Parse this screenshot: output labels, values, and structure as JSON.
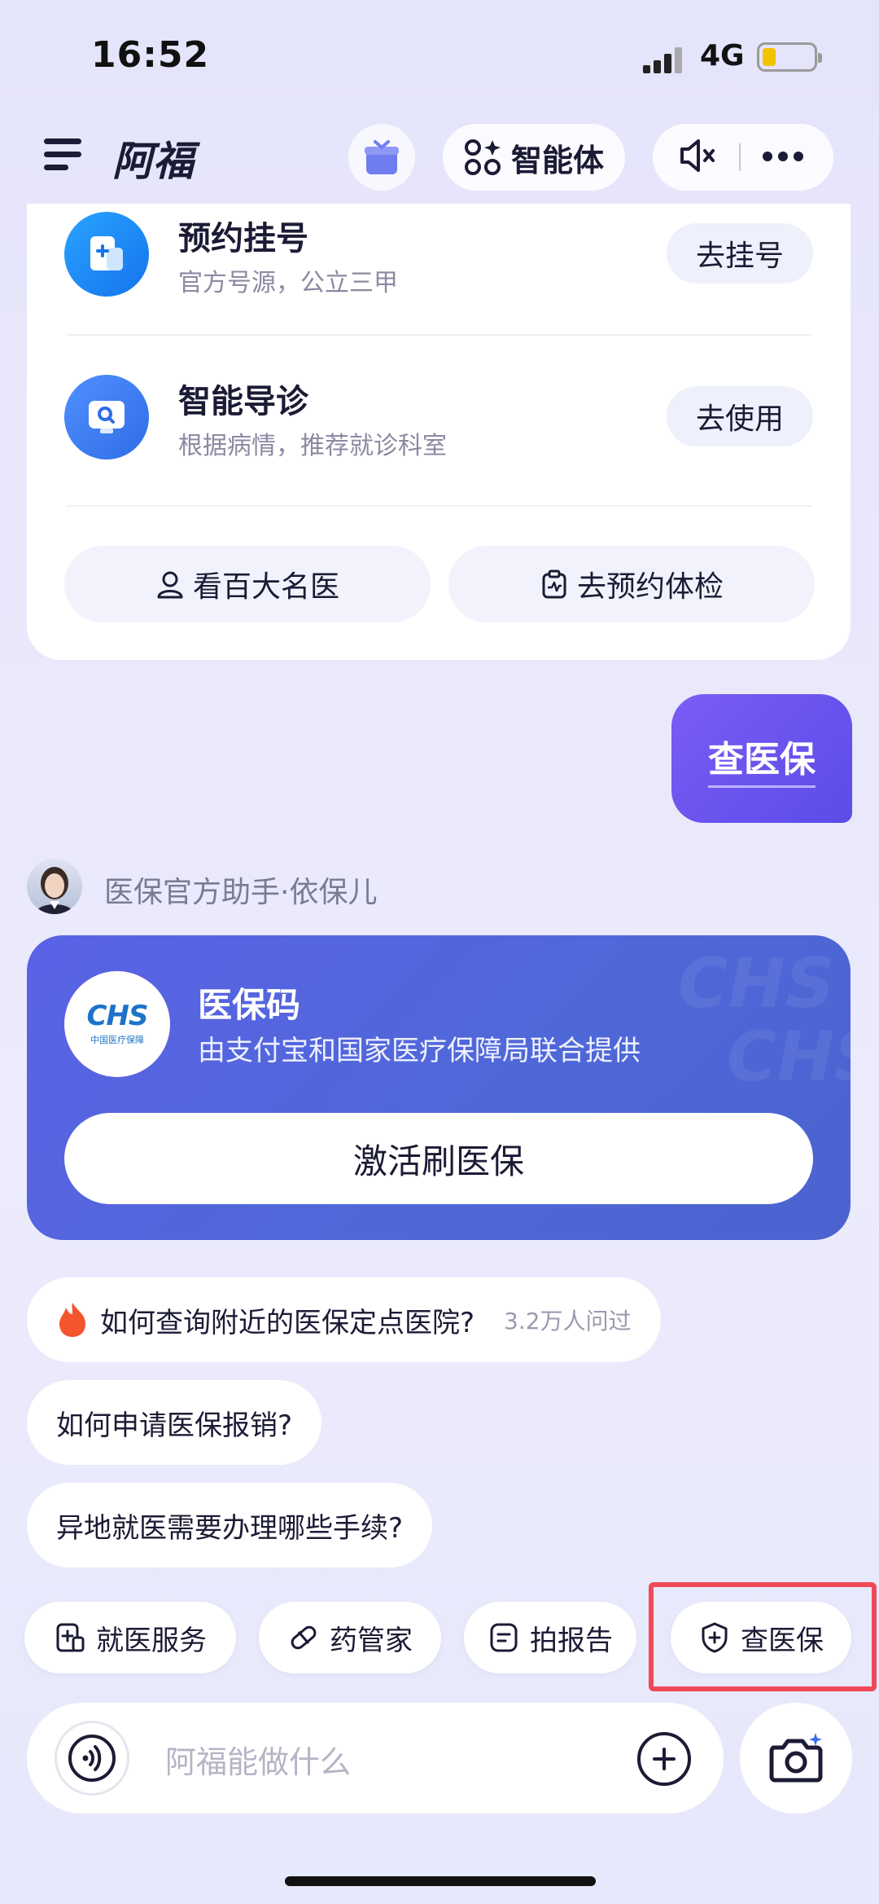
{
  "status": {
    "time": "16:52",
    "network": "4G"
  },
  "header": {
    "title": "阿福",
    "agent_label": "智能体"
  },
  "services": {
    "items": [
      {
        "title": "预约挂号",
        "subtitle": "官方号源，公立三甲",
        "button": "去挂号",
        "icon": "hospital-icon",
        "color": "#1e88f5"
      },
      {
        "title": "智能导诊",
        "subtitle": "根据病情，推荐就诊科室",
        "button": "去使用",
        "icon": "triage-icon",
        "color": "#3c7ff0"
      }
    ],
    "links": [
      {
        "label": "看百大名医",
        "icon": "doctor-icon"
      },
      {
        "label": "去预约体检",
        "icon": "checkup-icon"
      }
    ]
  },
  "user_message": {
    "text": "查医保"
  },
  "assistant": {
    "name": "医保官方助手·依保儿"
  },
  "insurance_card": {
    "title": "医保码",
    "subtitle": "由支付宝和国家医疗保障局联合提供",
    "button": "激活刷医保",
    "logo_text": "CHS",
    "logo_caption": "中国医疗保障",
    "accent": "#5a62e6"
  },
  "suggestions": [
    {
      "text": "如何查询附近的医保定点医院?",
      "count": "3.2万人问过",
      "hot": true
    },
    {
      "text": "如何申请医保报销?"
    },
    {
      "text": "异地就医需要办理哪些手续?"
    }
  ],
  "quick_actions": [
    {
      "label": "就医服务",
      "icon": "medical-service-icon"
    },
    {
      "label": "药管家",
      "icon": "pill-icon"
    },
    {
      "label": "拍报告",
      "icon": "report-icon"
    },
    {
      "label": "查医保",
      "icon": "insurance-shield-icon"
    }
  ],
  "input": {
    "placeholder": "阿福能做什么"
  }
}
